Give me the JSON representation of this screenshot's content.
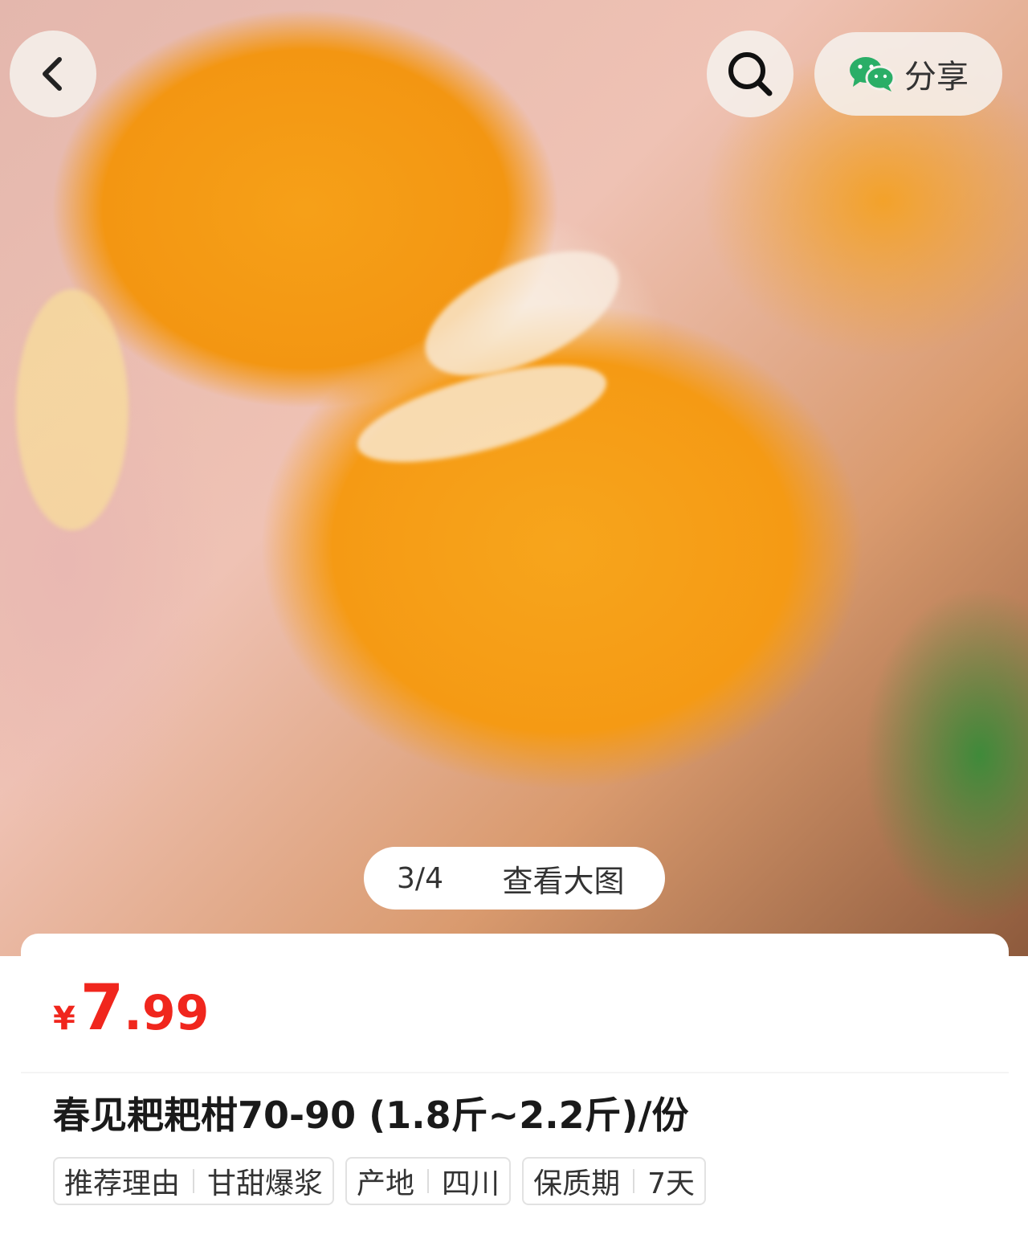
{
  "nav": {
    "back_icon": "chevron-left-icon",
    "search_icon": "search-icon",
    "share_icon": "wechat-icon",
    "share_label": "分享"
  },
  "gallery": {
    "counter": "3/4",
    "view_large_label": "查看大图",
    "current_index": 3,
    "total": 4
  },
  "product": {
    "currency": "¥",
    "price_int": "7",
    "price_dec": ".99",
    "title": "春见耙耙柑70-90 (1.8斤~2.2斤)/份",
    "tags": [
      {
        "key": "推荐理由",
        "value": "甘甜爆浆"
      },
      {
        "key": "产地",
        "value": "四川"
      },
      {
        "key": "保质期",
        "value": "7天"
      }
    ]
  },
  "colors": {
    "price": "#f0261d",
    "wechat_green": "#2aae67"
  }
}
